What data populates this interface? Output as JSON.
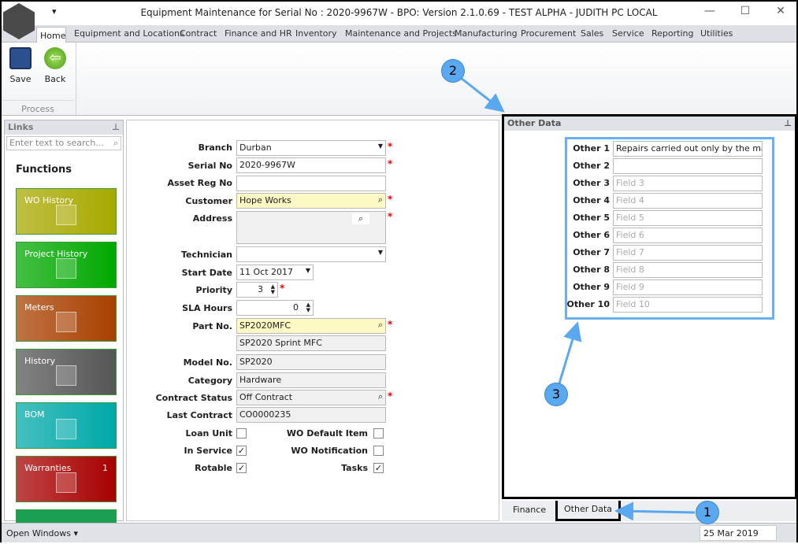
{
  "window": {
    "title": "Equipment Maintenance for Serial No : 2020-9967W - BPO: Version 2.1.0.69 - TEST ALPHA - JUDITH PC LOCAL",
    "qa_icon": "▾",
    "minimize": "—",
    "maximize": "☐",
    "close": "✕",
    "logo": "bpo"
  },
  "menu_tabs": [
    "Home",
    "Equipment and Locations",
    "Contract",
    "Finance and HR",
    "Inventory",
    "Maintenance and Projects",
    "Manufacturing",
    "Procurement",
    "Sales",
    "Service",
    "Reporting",
    "Utilities"
  ],
  "ribbon": {
    "save": "Save",
    "back": "Back",
    "group": "Process"
  },
  "links": {
    "title": "Links",
    "search_placeholder": "Enter text to search...",
    "functions": "Functions",
    "tiles": [
      {
        "label": "WO History",
        "color": "#a8a800"
      },
      {
        "label": "Project History",
        "color": "#00a800"
      },
      {
        "label": "Meters",
        "color": "#a84000"
      },
      {
        "label": "History",
        "color": "#555555"
      },
      {
        "label": "BOM",
        "color": "#00a8a8"
      },
      {
        "label": "Warranties",
        "count": "1",
        "color": "#a80000"
      }
    ]
  },
  "form": {
    "branch": {
      "label": "Branch",
      "value": "Durban"
    },
    "serial": {
      "label": "Serial No",
      "value": "2020-9967W"
    },
    "asset": {
      "label": "Asset Reg No",
      "value": ""
    },
    "customer": {
      "label": "Customer",
      "value": "Hope Works"
    },
    "address": {
      "label": "Address",
      "value": ""
    },
    "technician": {
      "label": "Technician",
      "value": ""
    },
    "start_date": {
      "label": "Start Date",
      "value": "11 Oct 2017"
    },
    "priority": {
      "label": "Priority",
      "value": "3"
    },
    "sla": {
      "label": "SLA Hours",
      "value": "0"
    },
    "part": {
      "label": "Part No.",
      "value": "SP2020MFC",
      "description": "SP2020 Sprint MFC"
    },
    "model": {
      "label": "Model No.",
      "value": "SP2020"
    },
    "category": {
      "label": "Category",
      "value": "Hardware"
    },
    "contract_status": {
      "label": "Contract Status",
      "value": "Off Contract"
    },
    "last_contract": {
      "label": "Last Contract",
      "value": "CO0000235"
    },
    "loan_unit": {
      "label": "Loan Unit",
      "checked": false
    },
    "in_service": {
      "label": "In Service",
      "checked": true
    },
    "rotable": {
      "label": "Rotable",
      "checked": true
    },
    "wo_default": {
      "label": "WO Default Item",
      "checked": false
    },
    "wo_notification": {
      "label": "WO Notification",
      "checked": false
    },
    "tasks": {
      "label": "Tasks",
      "checked": true
    }
  },
  "other_data": {
    "title": "Other Data",
    "fields": [
      {
        "label": "Other 1",
        "value": "Repairs carried out only by the manufa",
        "placeholder": ""
      },
      {
        "label": "Other 2",
        "value": "",
        "placeholder": ""
      },
      {
        "label": "Other 3",
        "value": "",
        "placeholder": "Field 3"
      },
      {
        "label": "Other 4",
        "value": "",
        "placeholder": "Field 4"
      },
      {
        "label": "Other 5",
        "value": "",
        "placeholder": "Field 5"
      },
      {
        "label": "Other 6",
        "value": "",
        "placeholder": "Field 6"
      },
      {
        "label": "Other 7",
        "value": "",
        "placeholder": "Field 7"
      },
      {
        "label": "Other 8",
        "value": "",
        "placeholder": "Field 8"
      },
      {
        "label": "Other 9",
        "value": "",
        "placeholder": "Field 9"
      },
      {
        "label": "Other 10",
        "value": "",
        "placeholder": "Field 10"
      }
    ]
  },
  "bottom_tabs": {
    "finance": "Finance",
    "other_data": "Other Data"
  },
  "status": {
    "open_windows": "Open Windows ▾",
    "date": "25 Mar 2019"
  },
  "annotations": [
    "1",
    "2",
    "3"
  ],
  "colors": {
    "annotation": "#5aa8f0",
    "required": "#ee0000",
    "lookup_bg": "#fdf9c4"
  }
}
